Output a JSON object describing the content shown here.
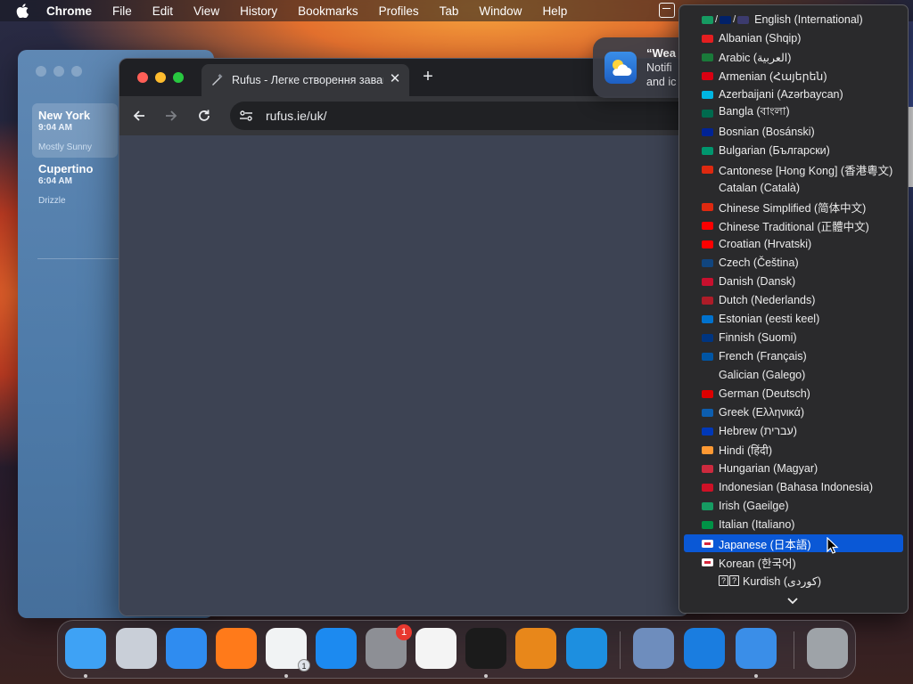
{
  "menubar": {
    "app_name": "Chrome",
    "items": [
      "File",
      "Edit",
      "View",
      "History",
      "Bookmarks",
      "Profiles",
      "Tab",
      "Window",
      "Help"
    ]
  },
  "weather_app": {
    "cities": [
      {
        "name": "New York",
        "time": "9:04 AM",
        "condition": "Mostly Sunny"
      },
      {
        "name": "Cupertino",
        "time": "6:04 AM",
        "condition": "Drizzle"
      }
    ]
  },
  "browser": {
    "tab_title": "Rufus - Легке створення завантажувальних USB-дисків",
    "tab_close": "✕",
    "new_tab": "+",
    "url_domain": "rufus.ie",
    "url_path": "/uk/"
  },
  "notification": {
    "title": "“Wea",
    "body_line1": "Notifi",
    "body_line2": "and ic"
  },
  "language_menu": {
    "selected_index": 28,
    "items": [
      {
        "label": "English (International)",
        "flags": [
          "#169b62",
          "#012169",
          "#3c3b6e"
        ],
        "multi": true
      },
      {
        "label": "Albanian (Shqip)",
        "flags": [
          "#e41e20"
        ]
      },
      {
        "label": "Arabic (العربية)",
        "flags": [
          "#1a7a3a"
        ]
      },
      {
        "label": "Armenian (Հայերեն)",
        "flags": [
          "#d90012"
        ]
      },
      {
        "label": "Azerbaijani (Azərbaycan)",
        "flags": [
          "#00b5e2"
        ]
      },
      {
        "label": "Bangla (বাংলা)",
        "flags": [
          "#006a4e"
        ]
      },
      {
        "label": "Bosnian (Bosánski)",
        "flags": [
          "#002395"
        ]
      },
      {
        "label": "Bulgarian (Български)",
        "flags": [
          "#00966e"
        ]
      },
      {
        "label": "Cantonese [Hong Kong] (香港粵文)",
        "flags": [
          "#de2910"
        ]
      },
      {
        "label": "Catalan (Català)",
        "flags": [
          "#2a2a2c"
        ]
      },
      {
        "label": "Chinese Simplified (简体中文)",
        "flags": [
          "#de2910"
        ]
      },
      {
        "label": "Chinese Traditional (正體中文)",
        "flags": [
          "#fe0000"
        ]
      },
      {
        "label": "Croatian (Hrvatski)",
        "flags": [
          "#ff0000"
        ]
      },
      {
        "label": "Czech (Čeština)",
        "flags": [
          "#11457e"
        ]
      },
      {
        "label": "Danish (Dansk)",
        "flags": [
          "#c8102e"
        ]
      },
      {
        "label": "Dutch (Nederlands)",
        "flags": [
          "#ae1c28"
        ]
      },
      {
        "label": "Estonian (eesti keel)",
        "flags": [
          "#0072ce"
        ]
      },
      {
        "label": "Finnish (Suomi)",
        "flags": [
          "#003580"
        ]
      },
      {
        "label": "French (Français)",
        "flags": [
          "#0055a4"
        ]
      },
      {
        "label": "Galician (Galego)",
        "flags": [
          "#2a2a2c"
        ]
      },
      {
        "label": "German (Deutsch)",
        "flags": [
          "#dd0000"
        ]
      },
      {
        "label": "Greek (Ελληνικά)",
        "flags": [
          "#0d5eaf"
        ]
      },
      {
        "label": "Hebrew (עברית)",
        "flags": [
          "#0038b8"
        ]
      },
      {
        "label": "Hindi (हिंदी)",
        "flags": [
          "#ff9933"
        ]
      },
      {
        "label": "Hungarian (Magyar)",
        "flags": [
          "#cd2a3e"
        ]
      },
      {
        "label": "Indonesian (Bahasa Indonesia)",
        "flags": [
          "#ce1126"
        ]
      },
      {
        "label": "Irish (Gaeilge)",
        "flags": [
          "#169b62"
        ]
      },
      {
        "label": "Italian (Italiano)",
        "flags": [
          "#009246"
        ]
      },
      {
        "label": "Japanese (日本語)",
        "flags": [
          "#ffffff"
        ]
      },
      {
        "label": "Korean (한국어)",
        "flags": [
          "#ffffff"
        ]
      },
      {
        "label": "Kurdish (کوردی)",
        "flags": [
          "#2a2a2c"
        ],
        "boxed": true
      }
    ]
  },
  "dock": {
    "apps": [
      {
        "name": "Finder",
        "color": "#3ea2f5"
      },
      {
        "name": "Launchpad",
        "color": "#c9cfd8"
      },
      {
        "name": "Safari",
        "color": "#2f8cf0"
      },
      {
        "name": "Firefox",
        "color": "#ff7a1a"
      },
      {
        "name": "Chrome",
        "color": "#f1f3f4",
        "sub_badge": "1"
      },
      {
        "name": "App Store",
        "color": "#1c8af0"
      },
      {
        "name": "System Settings",
        "color": "#8d8f95",
        "badge": "1"
      },
      {
        "name": "TextEdit",
        "color": "#f4f4f4"
      },
      {
        "name": "Terminal",
        "color": "#1b1b1b"
      },
      {
        "name": "GarageBand",
        "color": "#e8871a"
      },
      {
        "name": "Visual Studio Code",
        "color": "#1d8fe0"
      },
      {
        "name": "VirtualBox",
        "color": "#6e8dbd"
      },
      {
        "name": "Migration",
        "color": "#1a7de0"
      },
      {
        "name": "Weather",
        "color": "#3a8ee8"
      },
      {
        "name": "Trash",
        "color": "#9ea3a8"
      }
    ]
  }
}
